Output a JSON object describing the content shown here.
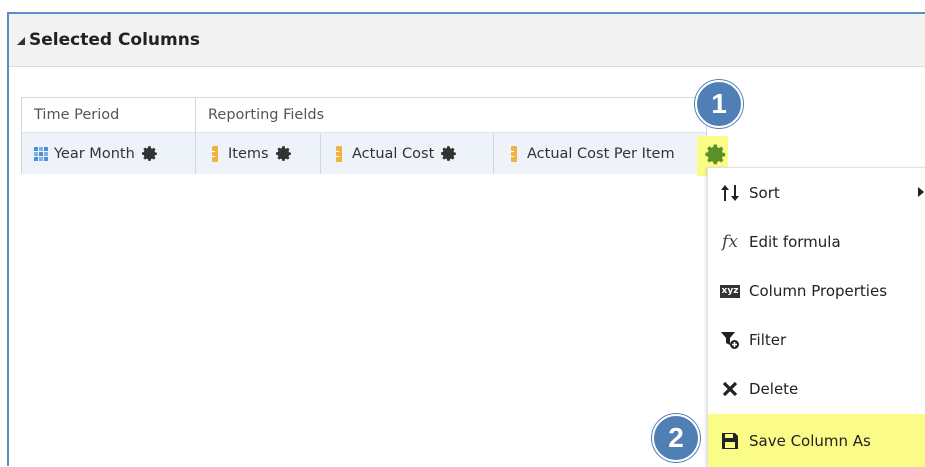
{
  "section": {
    "title": "Selected Columns"
  },
  "groups": [
    {
      "label": "Time Period"
    },
    {
      "label": "Reporting Fields"
    }
  ],
  "columns": [
    {
      "label": "Year Month",
      "icon": "hierarchy-grid-icon"
    },
    {
      "label": "Items",
      "icon": "measure-ruler-icon"
    },
    {
      "label": "Actual Cost",
      "icon": "measure-ruler-icon"
    },
    {
      "label": "Actual Cost Per Item",
      "icon": "measure-ruler-icon"
    }
  ],
  "badges": {
    "step1": "1",
    "step2": "2"
  },
  "menu": {
    "items": [
      {
        "label": "Sort",
        "icon": "sort-arrows-icon",
        "has_submenu": true
      },
      {
        "label": "Edit formula",
        "icon": "fx-icon"
      },
      {
        "label": "Column Properties",
        "icon": "xyz-icon"
      },
      {
        "label": "Filter",
        "icon": "filter-icon"
      },
      {
        "label": "Delete",
        "icon": "delete-x-icon"
      },
      {
        "label": "Save Column As",
        "icon": "save-disk-icon",
        "highlighted": true
      }
    ]
  },
  "colors": {
    "highlight": "#fbfb87",
    "badge": "#4f7fb5",
    "frame": "#5b8ec6",
    "gear_active": "#5a8f2a"
  }
}
